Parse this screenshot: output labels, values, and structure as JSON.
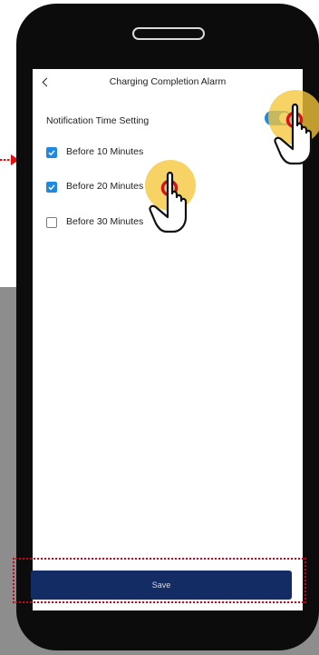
{
  "header": {
    "title": "Charging Completion Alarm"
  },
  "notification": {
    "label": "Notification Time Setting",
    "enabled": true
  },
  "options": [
    {
      "label": "Before 10 Minutes",
      "checked": true
    },
    {
      "label": "Before 20 Minutes",
      "checked": true
    },
    {
      "label": "Before 30 Minutes",
      "checked": false
    }
  ],
  "footer": {
    "save_label": "Save"
  },
  "colors": {
    "accent": "#1e88e5",
    "save_button": "#142c64",
    "highlight_outline": "#d0021b",
    "tap_indicator": "#f5c63b"
  },
  "icons": [
    "back-arrow-icon",
    "pointer-arrow-icon",
    "tap-hand-icon"
  ]
}
